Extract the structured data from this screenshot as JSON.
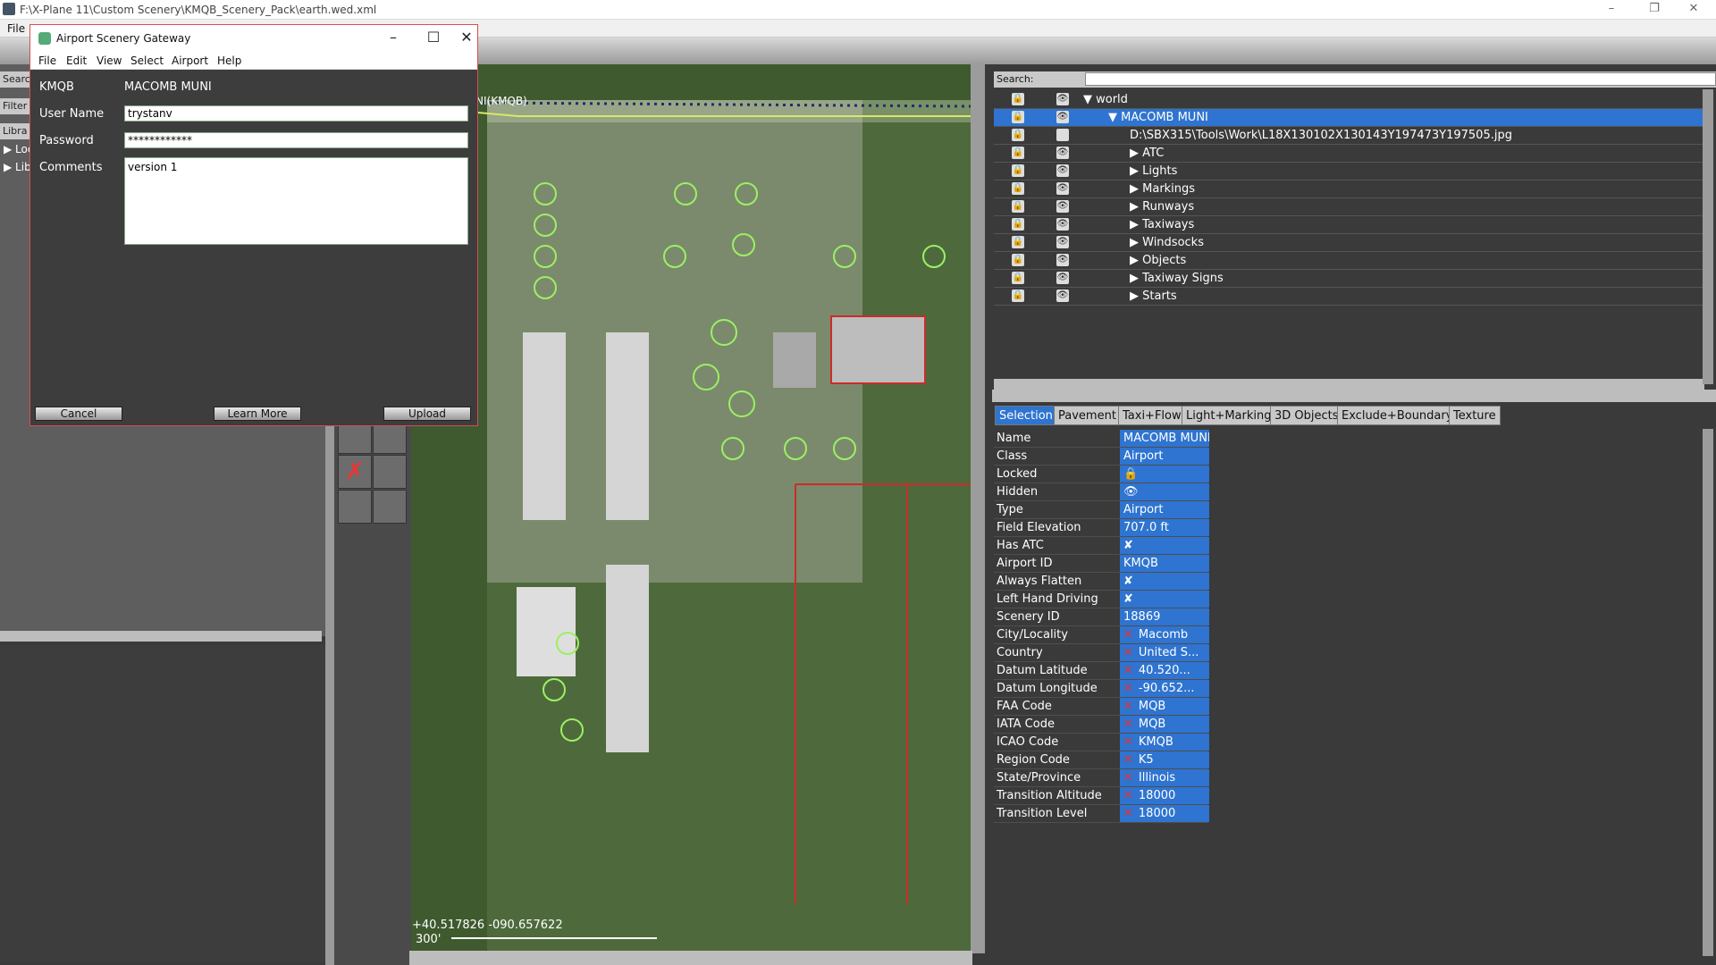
{
  "window": {
    "title": "F:\\X-Plane 11\\Custom Scenery\\KMQB_Scenery_Pack\\earth.wed.xml",
    "menu_file": "File"
  },
  "left": {
    "search_label": "Search",
    "filter_label": "Filter",
    "library_label": "Libra",
    "lib_item1": "Loc",
    "lib_item2": "Lib"
  },
  "map": {
    "coord": "+40.517826 -090.657622",
    "scale": "300'",
    "airport_label": "NI(KMQB)"
  },
  "dialog": {
    "title": "Airport Scenery Gateway",
    "menu": [
      "File",
      "Edit",
      "View",
      "Select",
      "Airport",
      "Help"
    ],
    "icao": "KMQB",
    "name": "MACOMB MUNI",
    "user_label": "User Name",
    "user_value": "trystanv",
    "pass_label": "Password",
    "pass_value": "************",
    "comments_label": "Comments",
    "comments_value": "version 1",
    "cancel": "Cancel",
    "learn_more": "Learn More",
    "upload": "Upload"
  },
  "tree": {
    "search_label": "Search:",
    "items": [
      {
        "label": "▼ world"
      },
      {
        "label": "▼ MACOMB MUNI"
      },
      {
        "label": "D:\\SBX315\\Tools\\Work\\L18X130102X130143Y197473Y197505.jpg"
      },
      {
        "label": "▶ ATC"
      },
      {
        "label": "▶ Lights"
      },
      {
        "label": "▶ Markings"
      },
      {
        "label": "▶ Runways"
      },
      {
        "label": "▶ Taxiways"
      },
      {
        "label": "▶ Windsocks"
      },
      {
        "label": "▶ Objects"
      },
      {
        "label": "▶ Taxiway Signs"
      },
      {
        "label": "▶ Starts"
      }
    ]
  },
  "tabs": [
    "Selection",
    "Pavement",
    "Taxi+Flow",
    "Light+Marking",
    "3D Objects",
    "Exclude+Boundary",
    "Texture"
  ],
  "props": [
    {
      "name": "Name",
      "value": "MACOMB MUNI",
      "x": false
    },
    {
      "name": "Class",
      "value": "Airport",
      "x": false
    },
    {
      "name": "Locked",
      "value": "🔒",
      "x": false
    },
    {
      "name": "Hidden",
      "value": "👁",
      "x": false
    },
    {
      "name": "Type",
      "value": "Airport",
      "x": false
    },
    {
      "name": "Field Elevation",
      "value": "707.0 ft",
      "x": false
    },
    {
      "name": "Has ATC",
      "value": "✘",
      "x": false
    },
    {
      "name": "Airport ID",
      "value": "KMQB",
      "x": false
    },
    {
      "name": "Always Flatten",
      "value": "✘",
      "x": false
    },
    {
      "name": "Left Hand Driving",
      "value": "✘",
      "x": false
    },
    {
      "name": "Scenery ID",
      "value": "18869",
      "x": false
    },
    {
      "name": "City/Locality",
      "value": "Macomb",
      "x": true
    },
    {
      "name": "Country",
      "value": "United S...",
      "x": true
    },
    {
      "name": "Datum Latitude",
      "value": "40.520...",
      "x": true
    },
    {
      "name": "Datum Longitude",
      "value": "-90.652...",
      "x": true
    },
    {
      "name": "FAA Code",
      "value": "MQB",
      "x": true
    },
    {
      "name": "IATA Code",
      "value": "MQB",
      "x": true
    },
    {
      "name": "ICAO Code",
      "value": "KMQB",
      "x": true
    },
    {
      "name": "Region Code",
      "value": "K5",
      "x": true
    },
    {
      "name": "State/Province",
      "value": "Illinois",
      "x": true
    },
    {
      "name": "Transition Altitude",
      "value": "18000",
      "x": true
    },
    {
      "name": "Transition Level",
      "value": "18000",
      "x": true
    }
  ]
}
